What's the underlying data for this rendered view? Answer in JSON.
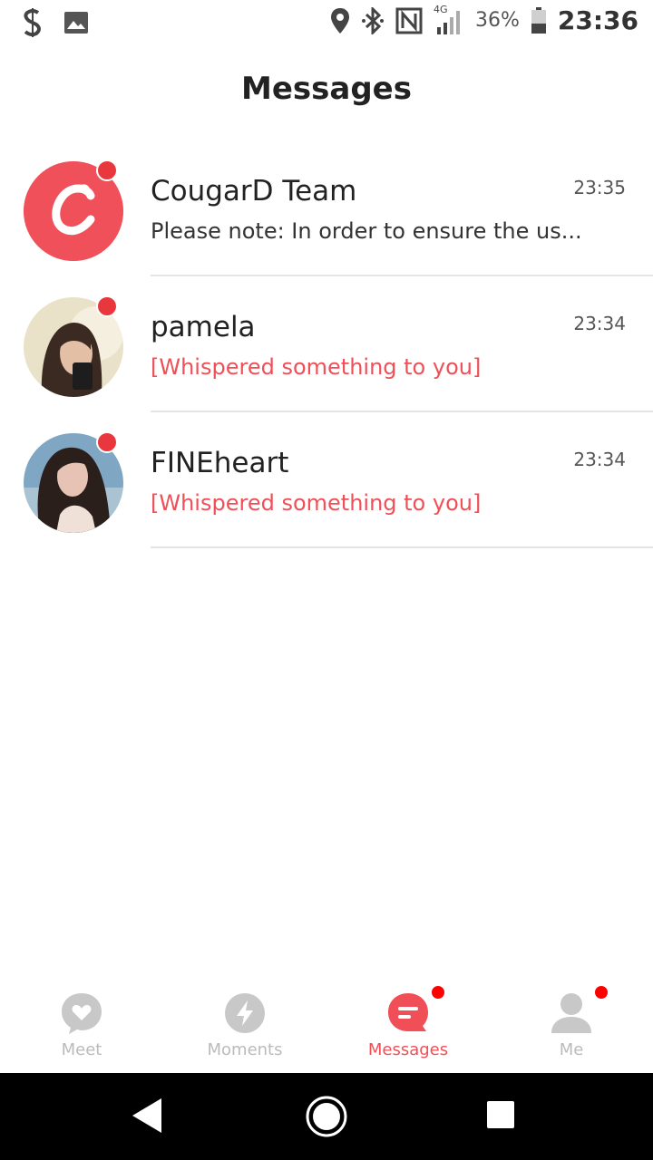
{
  "status_bar": {
    "battery_percent": "36%",
    "time": "23:36",
    "network": "4G",
    "icons": [
      "s-app-icon",
      "image-icon",
      "location-icon",
      "bluetooth-icon",
      "nfc-icon",
      "signal-icon",
      "battery-icon"
    ]
  },
  "header": {
    "title": "Messages"
  },
  "messages": [
    {
      "name": "CougarD Team",
      "time": "23:35",
      "preview": "Please note: In order to ensure the us...",
      "preview_style": "normal",
      "unread": true,
      "avatar": "cougard-logo"
    },
    {
      "name": "pamela",
      "time": "23:34",
      "preview": "[Whispered something to you]",
      "preview_style": "highlight",
      "unread": true,
      "avatar": "user-photo"
    },
    {
      "name": "FINEheart",
      "time": "23:34",
      "preview": "[Whispered something to you]",
      "preview_style": "highlight",
      "unread": true,
      "avatar": "user-photo"
    }
  ],
  "bottom_nav": [
    {
      "label": "Meet",
      "icon": "heart-bubble-icon",
      "active": false,
      "badge": false
    },
    {
      "label": "Moments",
      "icon": "lightning-icon",
      "active": false,
      "badge": false
    },
    {
      "label": "Messages",
      "icon": "chat-icon",
      "active": true,
      "badge": true
    },
    {
      "label": "Me",
      "icon": "person-icon",
      "active": false,
      "badge": true
    }
  ],
  "colors": {
    "accent": "#f04f57",
    "badge": "#e8383d",
    "inactive": "#bbbbbb"
  }
}
